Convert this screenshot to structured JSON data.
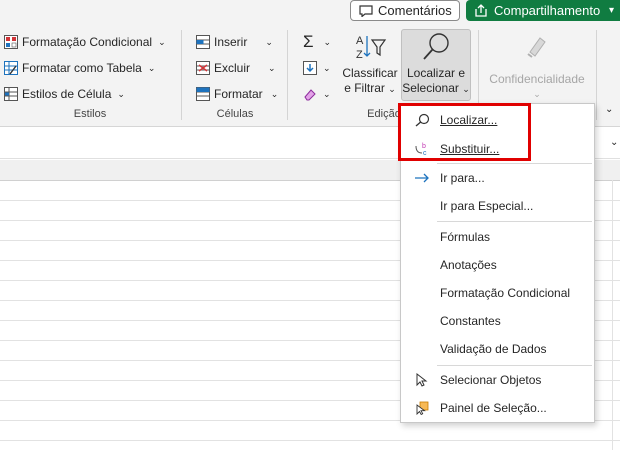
{
  "top": {
    "comments_label": "Comentários",
    "share_label": "Compartilhamento",
    "share_color": "#107c41"
  },
  "ribbon": {
    "styles": {
      "conditional_formatting": "Formatação Condicional",
      "format_as_table": "Formatar como Tabela",
      "cell_styles": "Estilos de Célula",
      "group_label": "Estilos"
    },
    "cells": {
      "insert": "Inserir",
      "delete": "Excluir",
      "format": "Formatar",
      "group_label": "Células"
    },
    "editing": {
      "sort_filter_line1": "Classificar",
      "sort_filter_line2": "e Filtrar",
      "find_select_line1": "Localizar e",
      "find_select_line2": "Selecionar",
      "group_label": "Edição"
    },
    "sensitivity": {
      "label": "Confidencialidade"
    }
  },
  "menu": {
    "find": "Localizar...",
    "replace": "Substituir...",
    "goto": "Ir para...",
    "goto_special": "Ir para Especial...",
    "formulas": "Fórmulas",
    "notes": "Anotações",
    "conditional_formatting": "Formatação Condicional",
    "constants": "Constantes",
    "data_validation": "Validação de Dados",
    "select_objects": "Selecionar Objetos",
    "selection_pane": "Painel de Seleção..."
  },
  "colors": {
    "highlight": "#e00000",
    "accent_blue": "#1e73be"
  }
}
